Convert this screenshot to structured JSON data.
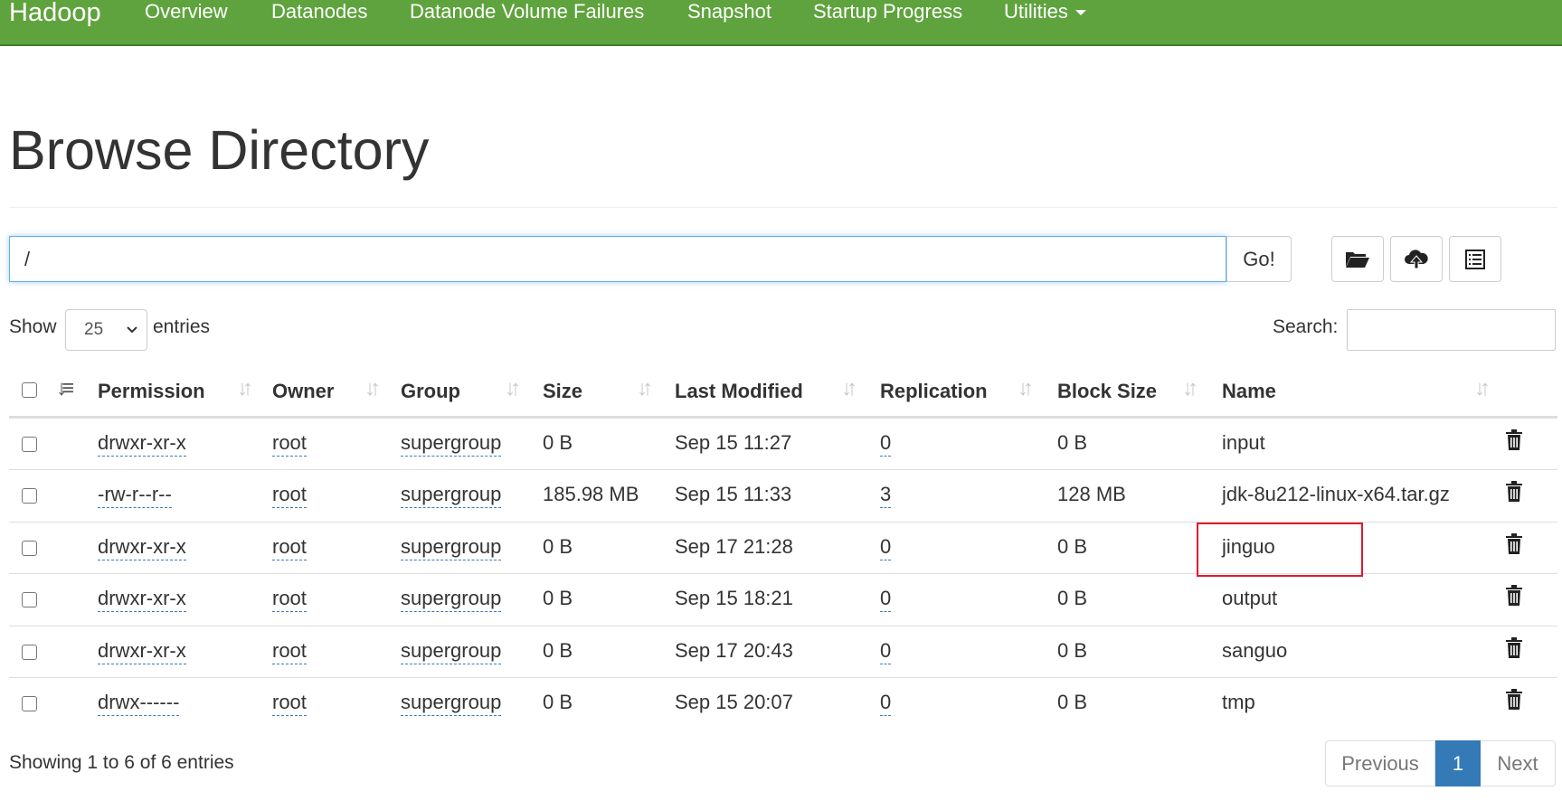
{
  "navbar": {
    "brand": "Hadoop",
    "items": [
      "Overview",
      "Datanodes",
      "Datanode Volume Failures",
      "Snapshot",
      "Startup Progress",
      "Utilities"
    ]
  },
  "page": {
    "title": "Browse Directory"
  },
  "pathbar": {
    "value": "/",
    "go_label": "Go!"
  },
  "toolbar_icons": [
    "folder-open-icon",
    "cloud-upload-icon",
    "list-alt-icon"
  ],
  "length": {
    "show_label": "Show",
    "selected": "25",
    "entries_label": "entries"
  },
  "search": {
    "label": "Search:",
    "value": ""
  },
  "table": {
    "columns": [
      "Permission",
      "Owner",
      "Group",
      "Size",
      "Last Modified",
      "Replication",
      "Block Size",
      "Name"
    ],
    "rows": [
      {
        "permission": "drwxr-xr-x",
        "owner": "root",
        "group": "supergroup",
        "size": "0 B",
        "modified": "Sep 15 11:27",
        "replication": "0",
        "block_size": "0 B",
        "name": "input"
      },
      {
        "permission": "-rw-r--r--",
        "owner": "root",
        "group": "supergroup",
        "size": "185.98 MB",
        "modified": "Sep 15 11:33",
        "replication": "3",
        "block_size": "128 MB",
        "name": "jdk-8u212-linux-x64.tar.gz"
      },
      {
        "permission": "drwxr-xr-x",
        "owner": "root",
        "group": "supergroup",
        "size": "0 B",
        "modified": "Sep 17 21:28",
        "replication": "0",
        "block_size": "0 B",
        "name": "jinguo"
      },
      {
        "permission": "drwxr-xr-x",
        "owner": "root",
        "group": "supergroup",
        "size": "0 B",
        "modified": "Sep 15 18:21",
        "replication": "0",
        "block_size": "0 B",
        "name": "output"
      },
      {
        "permission": "drwxr-xr-x",
        "owner": "root",
        "group": "supergroup",
        "size": "0 B",
        "modified": "Sep 17 20:43",
        "replication": "0",
        "block_size": "0 B",
        "name": "sanguo"
      },
      {
        "permission": "drwx------",
        "owner": "root",
        "group": "supergroup",
        "size": "0 B",
        "modified": "Sep 15 20:07",
        "replication": "0",
        "block_size": "0 B",
        "name": "tmp"
      }
    ]
  },
  "footer": {
    "info": "Showing 1 to 6 of 6 entries",
    "previous": "Previous",
    "page": "1",
    "next": "Next"
  },
  "colors": {
    "navbar": "#5fa33e",
    "link": "#2a78b8",
    "pager_active": "#337ab7",
    "highlight": "#e0182c"
  }
}
